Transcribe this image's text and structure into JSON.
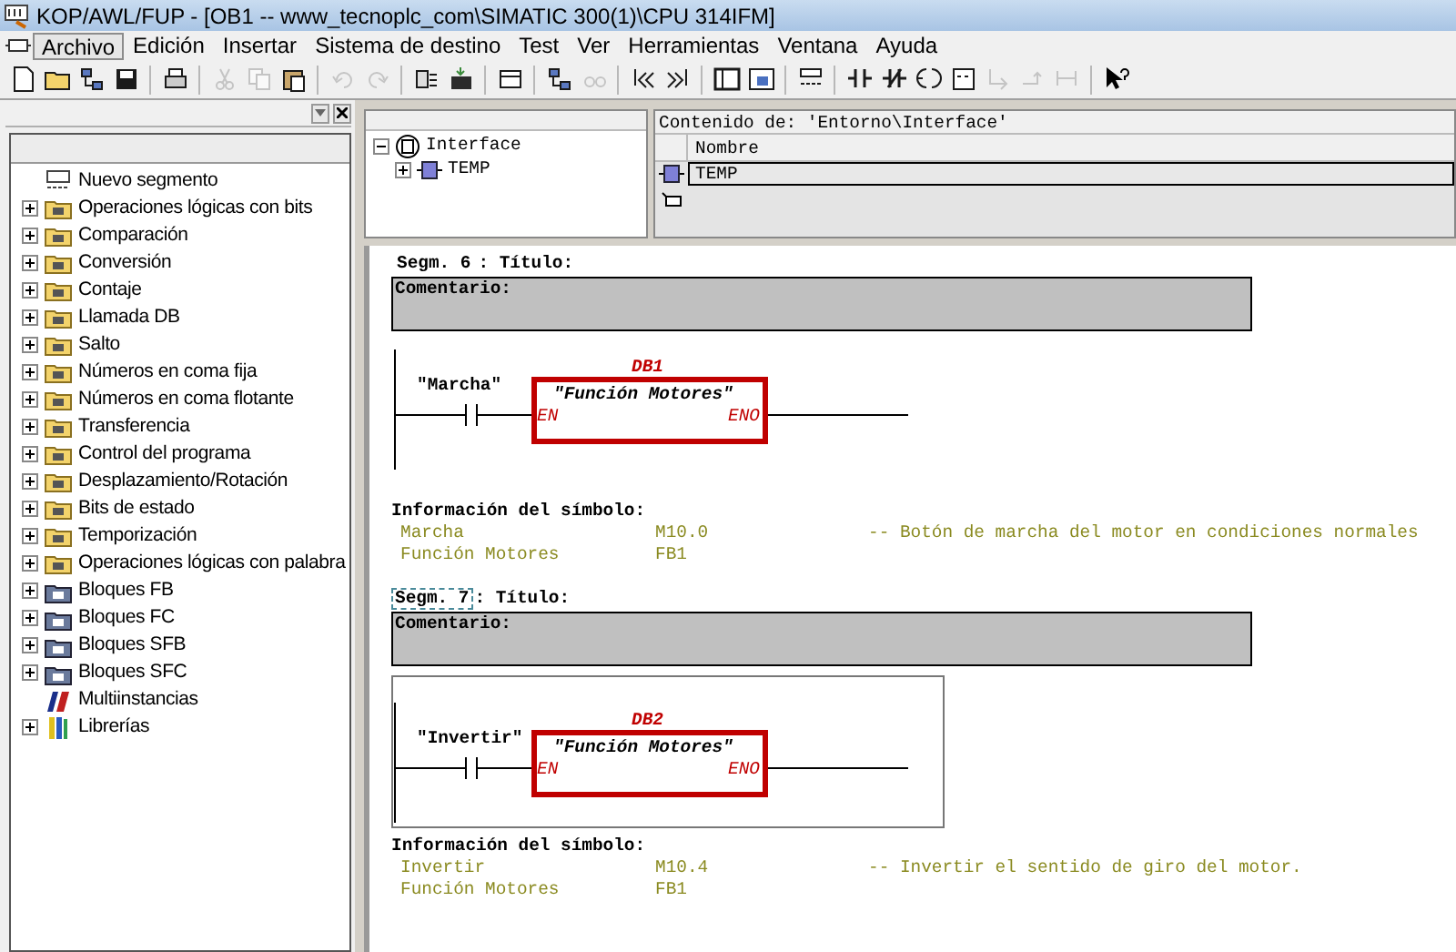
{
  "window": {
    "title": "KOP/AWL/FUP  - [OB1 -- www_tecnoplc_com\\SIMATIC 300(1)\\CPU 314IFM]"
  },
  "menu": [
    {
      "label": "Archivo",
      "selected": true
    },
    {
      "label": "Edición",
      "selected": false
    },
    {
      "label": "Insertar",
      "selected": false
    },
    {
      "label": "Sistema de destino",
      "selected": false
    },
    {
      "label": "Test",
      "selected": false
    },
    {
      "label": "Ver",
      "selected": false
    },
    {
      "label": "Herramientas",
      "selected": false
    },
    {
      "label": "Ventana",
      "selected": false
    },
    {
      "label": "Ayuda",
      "selected": false
    }
  ],
  "toolbar": [
    {
      "kind": "page",
      "disabled": false
    },
    {
      "kind": "folder",
      "disabled": false
    },
    {
      "kind": "network",
      "disabled": false
    },
    {
      "kind": "save",
      "disabled": false
    },
    {
      "kind": "sep"
    },
    {
      "kind": "print",
      "disabled": false
    },
    {
      "kind": "sep"
    },
    {
      "kind": "cut",
      "disabled": true
    },
    {
      "kind": "copy",
      "disabled": true
    },
    {
      "kind": "paste",
      "disabled": false
    },
    {
      "kind": "sep"
    },
    {
      "kind": "undo",
      "disabled": true
    },
    {
      "kind": "redo",
      "disabled": true
    },
    {
      "kind": "sep"
    },
    {
      "kind": "block",
      "disabled": false
    },
    {
      "kind": "download",
      "disabled": false
    },
    {
      "kind": "sep"
    },
    {
      "kind": "window",
      "disabled": false
    },
    {
      "kind": "sep"
    },
    {
      "kind": "network",
      "disabled": false
    },
    {
      "kind": "glasses",
      "disabled": true
    },
    {
      "kind": "sep"
    },
    {
      "kind": "prev",
      "disabled": false
    },
    {
      "kind": "next",
      "disabled": false
    },
    {
      "kind": "sep"
    },
    {
      "kind": "panel",
      "disabled": false
    },
    {
      "kind": "zoom",
      "disabled": false
    },
    {
      "kind": "sep"
    },
    {
      "kind": "segment",
      "disabled": false
    },
    {
      "kind": "sep"
    },
    {
      "kind": "no",
      "disabled": false
    },
    {
      "kind": "nc",
      "disabled": false
    },
    {
      "kind": "coil",
      "disabled": false
    },
    {
      "kind": "box",
      "disabled": false
    },
    {
      "kind": "branch",
      "disabled": true
    },
    {
      "kind": "close-branch",
      "disabled": true
    },
    {
      "kind": "open-branch",
      "disabled": true
    },
    {
      "kind": "sep"
    },
    {
      "kind": "help",
      "disabled": false
    }
  ],
  "catalog": [
    {
      "label": "Nuevo segmento",
      "kind": "segment",
      "expandable": false
    },
    {
      "label": "Operaciones lógicas con bits",
      "kind": "folder",
      "expandable": true
    },
    {
      "label": "Comparación",
      "kind": "folder",
      "expandable": true
    },
    {
      "label": "Conversión",
      "kind": "folder",
      "expandable": true
    },
    {
      "label": "Contaje",
      "kind": "folder",
      "expandable": true
    },
    {
      "label": "Llamada DB",
      "kind": "folder",
      "expandable": true
    },
    {
      "label": "Salto",
      "kind": "folder",
      "expandable": true
    },
    {
      "label": "Números en coma fija",
      "kind": "folder",
      "expandable": true
    },
    {
      "label": "Números en coma flotante",
      "kind": "folder",
      "expandable": true
    },
    {
      "label": "Transferencia",
      "kind": "folder",
      "expandable": true
    },
    {
      "label": "Control del programa",
      "kind": "folder",
      "expandable": true
    },
    {
      "label": "Desplazamiento/Rotación",
      "kind": "folder",
      "expandable": true
    },
    {
      "label": "Bits de estado",
      "kind": "folder",
      "expandable": true
    },
    {
      "label": "Temporización",
      "kind": "folder",
      "expandable": true
    },
    {
      "label": "Operaciones lógicas con palabra",
      "kind": "folder",
      "expandable": true
    },
    {
      "label": "Bloques FB",
      "kind": "block",
      "expandable": true
    },
    {
      "label": "Bloques FC",
      "kind": "block",
      "expandable": true
    },
    {
      "label": "Bloques SFB",
      "kind": "block",
      "expandable": true
    },
    {
      "label": "Bloques SFC",
      "kind": "block",
      "expandable": true
    },
    {
      "label": "Multiinstancias",
      "kind": "multi",
      "expandable": false
    },
    {
      "label": "Librerías",
      "kind": "library",
      "expandable": true
    }
  ],
  "interface_tree": [
    {
      "label": "Interface",
      "expanded": true,
      "children": [
        {
          "label": "TEMP",
          "expanded": false
        }
      ]
    }
  ],
  "interface_table": {
    "heading": "Contenido de: 'Entorno\\Interface'",
    "columns": [
      "Nombre"
    ],
    "rows": [
      {
        "name": "TEMP",
        "selected": true
      }
    ]
  },
  "segments": [
    {
      "label": "Segm. 6",
      "title": ": Título:",
      "selected": false,
      "comment": "Comentario:",
      "contact": "\"Marcha\"",
      "instance": "DB1",
      "block": "\"Función Motores\"",
      "input": "EN",
      "output": "ENO",
      "symbol_heading": "Información del símbolo:",
      "symbols": [
        [
          "Marcha",
          "M10.0",
          "-- Botón de marcha del motor en condiciones normales"
        ],
        [
          "Función Motores",
          "FB1"
        ]
      ]
    },
    {
      "label": "Segm. 7",
      "title": ": Título:",
      "selected": true,
      "comment": "Comentario:",
      "contact": "\"Invertir\"",
      "instance": "DB2",
      "block": "\"Función Motores\"",
      "input": "EN",
      "output": "ENO",
      "symbol_heading": "Información del símbolo:",
      "symbols": [
        [
          "Invertir",
          "M10.4",
          "-- Invertir el sentido de giro del motor."
        ],
        [
          "Función Motores",
          "FB1"
        ]
      ]
    }
  ]
}
